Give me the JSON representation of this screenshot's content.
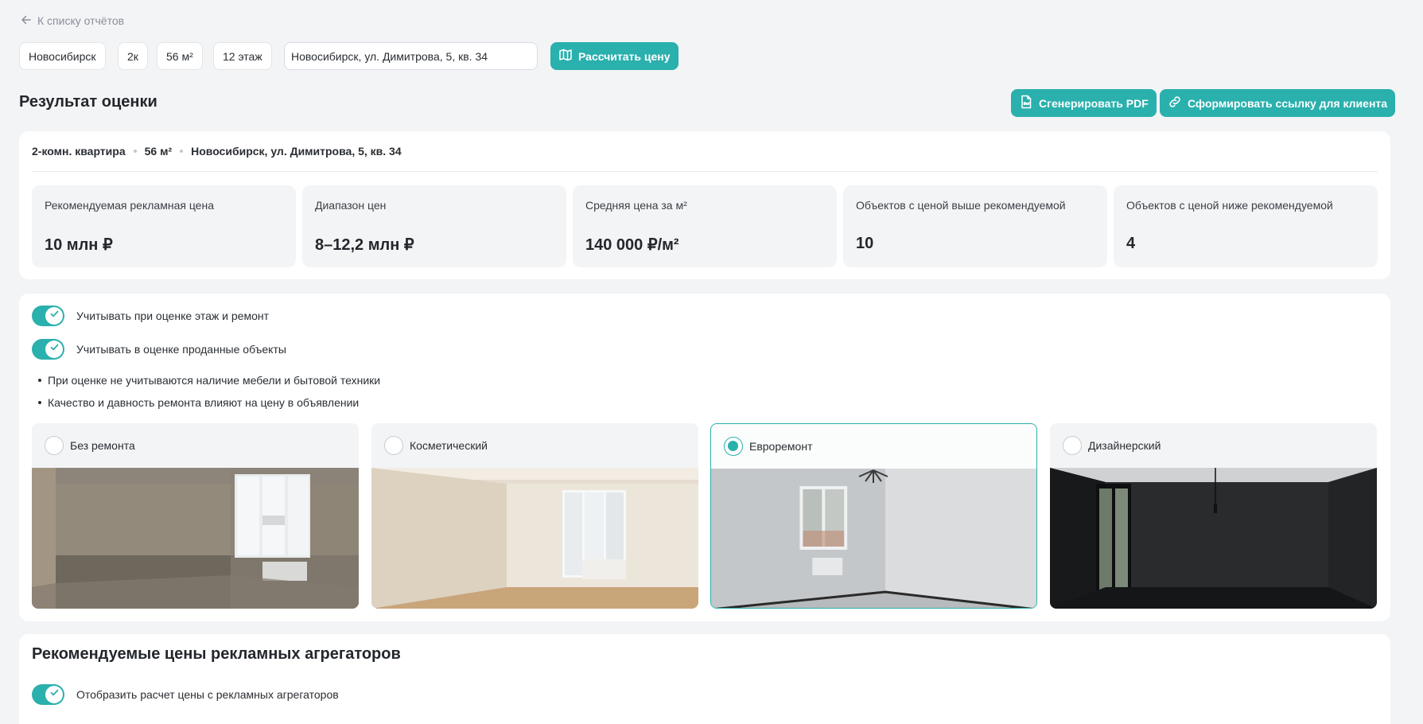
{
  "back_link": "К списку отчётов",
  "filters": {
    "city": "Новосибирск",
    "rooms": "2к",
    "area": "56 м²",
    "floor": "12 этаж",
    "address": "Новосибирск, ул. Димитрова, 5, кв. 34",
    "calculate_label": "Рассчитать цену"
  },
  "result": {
    "title": "Результат оценки",
    "pdf_label": "Сгенерировать PDF",
    "link_label": "Сформировать ссылку для клиента",
    "summary": {
      "type": "2-комн. квартира",
      "area": "56 м²",
      "address": "Новосибирск, ул. Димитрова, 5, кв. 34"
    },
    "stats": [
      {
        "label": "Рекомендуемая рекламная цена",
        "value": "10 млн ₽"
      },
      {
        "label": "Диапазон цен",
        "value": "8–12,2 млн ₽"
      },
      {
        "label": "Средняя цена за м²",
        "value": "140 000 ₽/м²"
      },
      {
        "label": "Объектов с ценой выше рекомендуемой",
        "value": "10"
      },
      {
        "label": "Объектов с ценой ниже рекомендуемой",
        "value": "4"
      }
    ]
  },
  "settings": {
    "toggles": [
      {
        "label": "Учитывать при оценке этаж и ремонт",
        "on": true
      },
      {
        "label": "Учитывать в оценке проданные объекты",
        "on": true
      }
    ],
    "notes": [
      "При оценке не учитываются наличие мебели и бытовой техники",
      "Качество и давность ремонта влияют на цену в объявлении"
    ],
    "renovation_options": [
      {
        "label": "Без ремонта",
        "selected": false
      },
      {
        "label": "Косметический",
        "selected": false
      },
      {
        "label": "Евроремонт",
        "selected": true
      },
      {
        "label": "Дизайнерский",
        "selected": false
      }
    ]
  },
  "aggregators": {
    "title": "Рекомендуемые цены рекламных агрегаторов",
    "toggle_label": "Отобразить расчет цены с рекламных агрегаторов",
    "toggle_on": true
  },
  "colors": {
    "accent": "#2ab0ad",
    "background": "#f3f4f6",
    "card": "#ffffff"
  }
}
